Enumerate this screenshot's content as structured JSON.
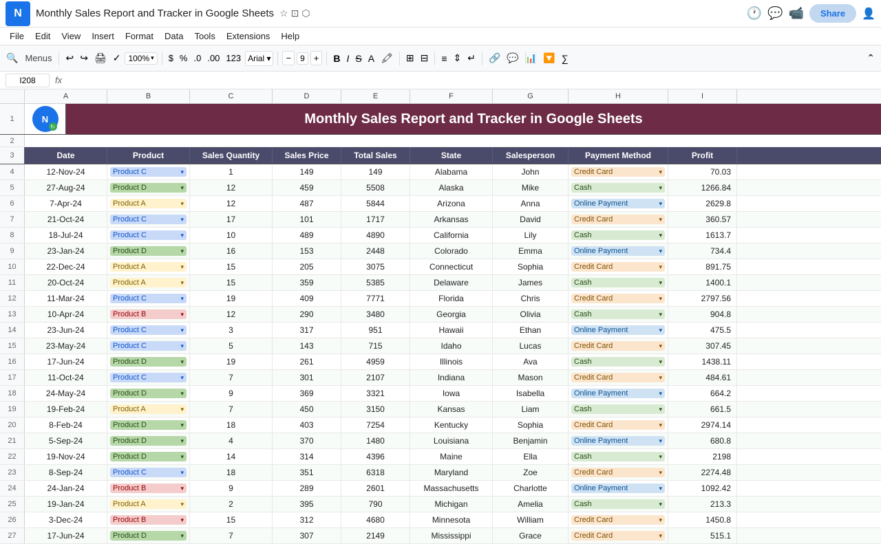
{
  "app": {
    "logo_text": "N",
    "title": "Monthly Sales Report and Tracker in Google Sheets",
    "star": "☆",
    "folder": "⊡",
    "drive": "⬡"
  },
  "menu": {
    "items": [
      "File",
      "Edit",
      "View",
      "Insert",
      "Format",
      "Data",
      "Tools",
      "Extensions",
      "Help"
    ]
  },
  "toolbar": {
    "menus_label": "Menus",
    "zoom": "100%",
    "font_size": "9",
    "currency": "$",
    "percent": "%"
  },
  "formula_bar": {
    "cell_ref": "I208",
    "fx": "fx"
  },
  "sheet": {
    "title": "Monthly Sales Report and Tracker in Google Sheets",
    "headers": [
      "Date",
      "Product",
      "Sales Quantity",
      "Sales Price",
      "Total Sales",
      "State",
      "Salesperson",
      "Payment Method",
      "Profit"
    ],
    "col_letters": [
      "A",
      "B",
      "C",
      "D",
      "E",
      "F",
      "G",
      "H",
      "I"
    ],
    "rows": [
      {
        "num": 4,
        "date": "12-Nov-24",
        "product": "Product C",
        "product_type": "c",
        "qty": 1,
        "price": 149,
        "total": 149,
        "state": "Alabama",
        "person": "John",
        "payment": "Credit Card",
        "payment_type": "cc",
        "profit": 70.03
      },
      {
        "num": 5,
        "date": "27-Aug-24",
        "product": "Product D",
        "product_type": "d",
        "qty": 12,
        "price": 459,
        "total": 5508,
        "state": "Alaska",
        "person": "Mike",
        "payment": "Cash",
        "payment_type": "cash",
        "profit": 1266.84
      },
      {
        "num": 6,
        "date": "7-Apr-24",
        "product": "Product A",
        "product_type": "a",
        "qty": 12,
        "price": 487,
        "total": 5844,
        "state": "Arizona",
        "person": "Anna",
        "payment": "Online Payment",
        "payment_type": "online",
        "profit": 2629.8
      },
      {
        "num": 7,
        "date": "21-Oct-24",
        "product": "Product C",
        "product_type": "c",
        "qty": 17,
        "price": 101,
        "total": 1717,
        "state": "Arkansas",
        "person": "David",
        "payment": "Credit Card",
        "payment_type": "cc",
        "profit": 360.57
      },
      {
        "num": 8,
        "date": "18-Jul-24",
        "product": "Product C",
        "product_type": "c",
        "qty": 10,
        "price": 489,
        "total": 4890,
        "state": "California",
        "person": "Lily",
        "payment": "Cash",
        "payment_type": "cash",
        "profit": 1613.7
      },
      {
        "num": 9,
        "date": "23-Jan-24",
        "product": "Product D",
        "product_type": "d",
        "qty": 16,
        "price": 153,
        "total": 2448,
        "state": "Colorado",
        "person": "Emma",
        "payment": "Online Payment",
        "payment_type": "online",
        "profit": 734.4
      },
      {
        "num": 10,
        "date": "22-Dec-24",
        "product": "Product A",
        "product_type": "a",
        "qty": 15,
        "price": 205,
        "total": 3075,
        "state": "Connecticut",
        "person": "Sophia",
        "payment": "Credit Card",
        "payment_type": "cc",
        "profit": 891.75
      },
      {
        "num": 11,
        "date": "20-Oct-24",
        "product": "Product A",
        "product_type": "a",
        "qty": 15,
        "price": 359,
        "total": 5385,
        "state": "Delaware",
        "person": "James",
        "payment": "Cash",
        "payment_type": "cash",
        "profit": 1400.1
      },
      {
        "num": 12,
        "date": "11-Mar-24",
        "product": "Product C",
        "product_type": "c",
        "qty": 19,
        "price": 409,
        "total": 7771,
        "state": "Florida",
        "person": "Chris",
        "payment": "Credit Card",
        "payment_type": "cc",
        "profit": 2797.56
      },
      {
        "num": 13,
        "date": "10-Apr-24",
        "product": "Product B",
        "product_type": "b",
        "qty": 12,
        "price": 290,
        "total": 3480,
        "state": "Georgia",
        "person": "Olivia",
        "payment": "Cash",
        "payment_type": "cash",
        "profit": 904.8
      },
      {
        "num": 14,
        "date": "23-Jun-24",
        "product": "Product C",
        "product_type": "c",
        "qty": 3,
        "price": 317,
        "total": 951,
        "state": "Hawaii",
        "person": "Ethan",
        "payment": "Online Payment",
        "payment_type": "online",
        "profit": 475.5
      },
      {
        "num": 15,
        "date": "23-May-24",
        "product": "Product C",
        "product_type": "c",
        "qty": 5,
        "price": 143,
        "total": 715,
        "state": "Idaho",
        "person": "Lucas",
        "payment": "Credit Card",
        "payment_type": "cc",
        "profit": 307.45
      },
      {
        "num": 16,
        "date": "17-Jun-24",
        "product": "Product D",
        "product_type": "d",
        "qty": 19,
        "price": 261,
        "total": 4959,
        "state": "Illinois",
        "person": "Ava",
        "payment": "Cash",
        "payment_type": "cash",
        "profit": 1438.11
      },
      {
        "num": 17,
        "date": "11-Oct-24",
        "product": "Product C",
        "product_type": "c",
        "qty": 7,
        "price": 301,
        "total": 2107,
        "state": "Indiana",
        "person": "Mason",
        "payment": "Credit Card",
        "payment_type": "cc",
        "profit": 484.61
      },
      {
        "num": 18,
        "date": "24-May-24",
        "product": "Product D",
        "product_type": "d",
        "qty": 9,
        "price": 369,
        "total": 3321,
        "state": "Iowa",
        "person": "Isabella",
        "payment": "Online Payment",
        "payment_type": "online",
        "profit": 664.2
      },
      {
        "num": 19,
        "date": "19-Feb-24",
        "product": "Product A",
        "product_type": "a",
        "qty": 7,
        "price": 450,
        "total": 3150,
        "state": "Kansas",
        "person": "Liam",
        "payment": "Cash",
        "payment_type": "cash",
        "profit": 661.5
      },
      {
        "num": 20,
        "date": "8-Feb-24",
        "product": "Product D",
        "product_type": "d",
        "qty": 18,
        "price": 403,
        "total": 7254,
        "state": "Kentucky",
        "person": "Sophia",
        "payment": "Credit Card",
        "payment_type": "cc",
        "profit": 2974.14
      },
      {
        "num": 21,
        "date": "5-Sep-24",
        "product": "Product D",
        "product_type": "d",
        "qty": 4,
        "price": 370,
        "total": 1480,
        "state": "Louisiana",
        "person": "Benjamin",
        "payment": "Online Payment",
        "payment_type": "online",
        "profit": 680.8
      },
      {
        "num": 22,
        "date": "19-Nov-24",
        "product": "Product D",
        "product_type": "d",
        "qty": 14,
        "price": 314,
        "total": 4396,
        "state": "Maine",
        "person": "Ella",
        "payment": "Cash",
        "payment_type": "cash",
        "profit": 2198
      },
      {
        "num": 23,
        "date": "8-Sep-24",
        "product": "Product C",
        "product_type": "c",
        "qty": 18,
        "price": 351,
        "total": 6318,
        "state": "Maryland",
        "person": "Zoe",
        "payment": "Credit Card",
        "payment_type": "cc",
        "profit": 2274.48
      },
      {
        "num": 24,
        "date": "24-Jan-24",
        "product": "Product B",
        "product_type": "b",
        "qty": 9,
        "price": 289,
        "total": 2601,
        "state": "Massachusetts",
        "person": "Charlotte",
        "payment": "Online Payment",
        "payment_type": "online",
        "profit": 1092.42
      },
      {
        "num": 25,
        "date": "19-Jan-24",
        "product": "Product A",
        "product_type": "a",
        "qty": 2,
        "price": 395,
        "total": 790,
        "state": "Michigan",
        "person": "Amelia",
        "payment": "Cash",
        "payment_type": "cash",
        "profit": 213.3
      },
      {
        "num": 26,
        "date": "3-Dec-24",
        "product": "Product B",
        "product_type": "b",
        "qty": 15,
        "price": 312,
        "total": 4680,
        "state": "Minnesota",
        "person": "William",
        "payment": "Credit Card",
        "payment_type": "cc",
        "profit": 1450.8
      },
      {
        "num": 27,
        "date": "17-Jun-24",
        "product": "Product D",
        "product_type": "d",
        "qty": 7,
        "price": 307,
        "total": 2149,
        "state": "Mississippi",
        "person": "Grace",
        "payment": "Credit Card",
        "payment_type": "cc",
        "profit": 515.1
      }
    ]
  },
  "share_button": "Share"
}
